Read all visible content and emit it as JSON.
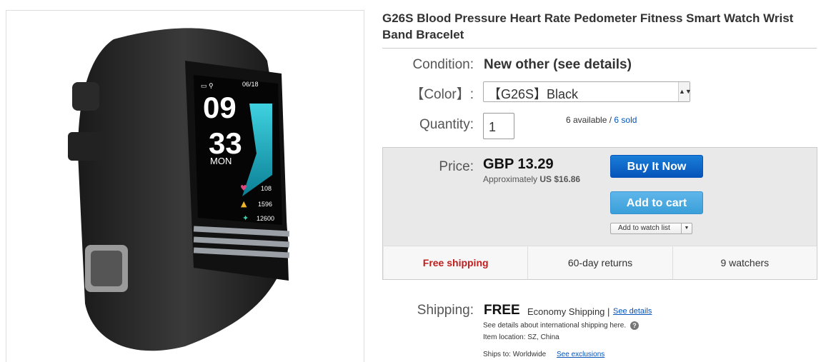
{
  "product": {
    "title": "G26S Blood Pressure Heart Rate Pedometer Fitness Smart Watch Wrist Band Bracelet",
    "screen": {
      "date": "06/18",
      "hour": "09",
      "minute": "33",
      "day": "MON",
      "heart_rate": "108",
      "calories": "1596",
      "steps": "12600"
    }
  },
  "condition": {
    "label": "Condition:",
    "value": "New other (see details)"
  },
  "color": {
    "label": "【Color】:",
    "selected": "【G26S】Black"
  },
  "quantity": {
    "label": "Quantity:",
    "value": "1",
    "available": "6 available",
    "separator": "/",
    "sold": "6 sold"
  },
  "price": {
    "label": "Price:",
    "value": "GBP 13.29",
    "approx_prefix": "Approximately",
    "approx_value": "US $16.86"
  },
  "buttons": {
    "buy_now": "Buy It Now",
    "add_to_cart": "Add to cart",
    "add_to_watch": "Add to watch list"
  },
  "info_row": {
    "shipping": "Free shipping",
    "returns": "60-day returns",
    "watchers": "9 watchers"
  },
  "shipping": {
    "label": "Shipping:",
    "free": "FREE",
    "method": "Economy Shipping |",
    "details_link": "See details",
    "intl_note": "See details about international shipping here.",
    "item_location": "Item location:  SZ, China",
    "ships_to": "Ships to:  Worldwide",
    "exclusions_link": "See exclusions"
  },
  "colors": {
    "accent_blue": "#0654ba",
    "cart_blue": "#3a9fd9",
    "free_red": "#c01d1d",
    "price_box": "#e9e9e9"
  }
}
